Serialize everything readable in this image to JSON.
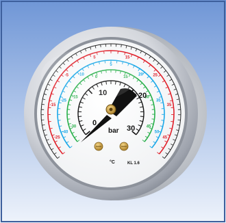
{
  "gauge": {
    "unit_bar": "bar",
    "unit_celsius": "°C",
    "class_label": "KL 1.6",
    "scale_labels": [
      "0",
      "10",
      "20",
      "30"
    ],
    "red_ring_labels": [
      "-25",
      "-15",
      "-5",
      "5",
      "15",
      "25",
      "35",
      "45"
    ],
    "blue_ring_labels": [
      "-40",
      "-25",
      "-10",
      "5",
      "20",
      "35",
      "50"
    ],
    "green_ring_labels": [
      "-30",
      "-15",
      "0",
      "15",
      "30",
      "45"
    ],
    "needle_value": 0,
    "colors": {
      "background_top": "#6f96d6",
      "background_bottom": "#eef3fb",
      "bezel": "#c9ccd2",
      "dial": "#ffffff",
      "red_ring": "#e0202a",
      "blue_ring": "#1aa8e8",
      "green_ring": "#28b04a",
      "needle": "#111111",
      "brass": "#c89b3c"
    }
  }
}
